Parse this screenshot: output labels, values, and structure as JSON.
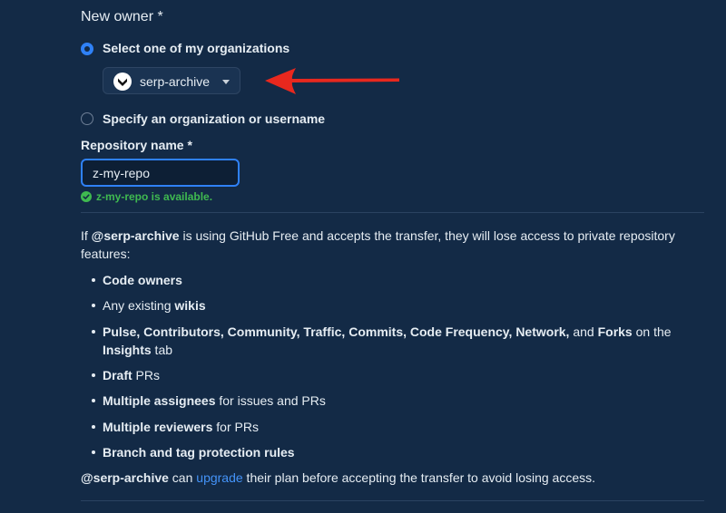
{
  "form": {
    "new_owner_label": "New owner *",
    "option_select_org_label": "Select one of my organizations",
    "option_specify_label": "Specify an organization or username",
    "org_dropdown_value": "serp-archive",
    "repo_name_label": "Repository name *",
    "repo_name_value": "z-my-repo",
    "availability_message": "z-my-repo is available."
  },
  "notice": {
    "intro_prefix": "If ",
    "intro_org": "@serp-archive",
    "intro_suffix": " is using GitHub Free and accepts the transfer, they will lose access to private repository features:",
    "bullets": [
      {
        "bold": "Code owners",
        "rest": ""
      },
      {
        "pre": "Any existing ",
        "bold": "wikis",
        "rest": ""
      },
      {
        "bold": "Pulse, Contributors, Community, Traffic, Commits, Code Frequency, Network,",
        "rest": " and ",
        "bold2": "Forks",
        "rest2": " on the ",
        "bold3": "Insights",
        "rest3": " tab"
      },
      {
        "bold": "Draft",
        "rest": " PRs"
      },
      {
        "bold": "Multiple assignees",
        "rest": " for issues and PRs"
      },
      {
        "bold": "Multiple reviewers",
        "rest": " for PRs"
      },
      {
        "bold": "Branch and tag protection rules",
        "rest": ""
      }
    ],
    "footer_org": "@serp-archive",
    "footer_mid": " can ",
    "footer_link": "upgrade",
    "footer_end": " their plan before accepting the transfer to avoid losing access."
  },
  "colors": {
    "background": "#132a46",
    "accent_blue": "#2f81f7",
    "success_green": "#3fb950",
    "annotation_arrow": "#e8281e"
  },
  "icons": {
    "org_avatar": "serp-archive-logo",
    "availability": "check-circle-icon",
    "dropdown": "caret-down-icon",
    "annotation": "red-arrow-annotation"
  }
}
